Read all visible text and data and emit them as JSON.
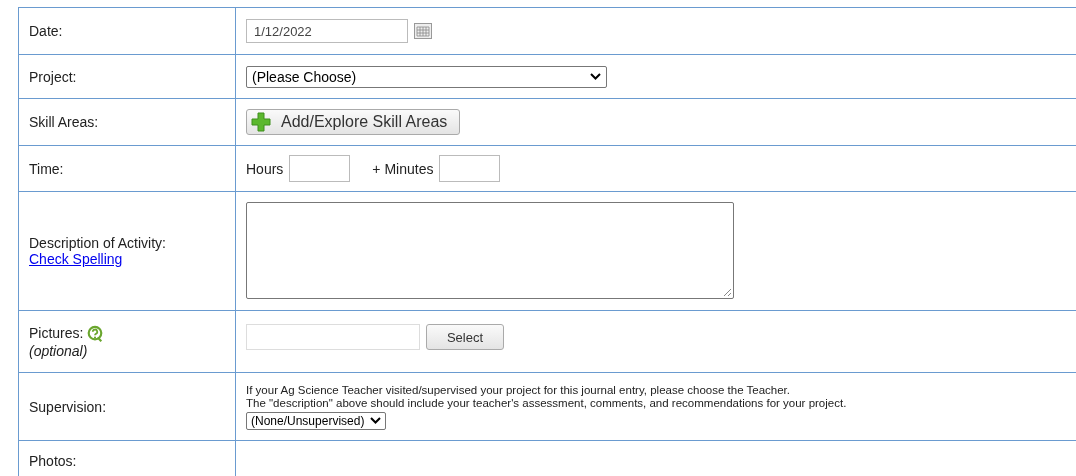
{
  "rows": [
    {
      "kind": "date",
      "label": "Date:",
      "value": "1/12/2022"
    },
    {
      "kind": "select",
      "label": "Project:",
      "value": "(Please Choose)"
    },
    {
      "kind": "button",
      "label": "Skill Areas:",
      "button": "Add/Explore Skill Areas"
    },
    {
      "kind": "time",
      "label": "Time:",
      "hours_label": "Hours",
      "minutes_label": "+ Minutes"
    },
    {
      "kind": "textarea",
      "label": "Description of Activity:",
      "link": "Check Spelling"
    },
    {
      "kind": "pictures",
      "label": "Pictures:",
      "note": "(optional)",
      "button": "Select"
    },
    {
      "kind": "supervision",
      "label": "Supervision:",
      "lines": [
        "If your Ag Science Teacher visited/supervised your project for this journal entry, please choose the Teacher.",
        "The \"description\" above should include your teacher's assessment, comments, and recommendations for your project."
      ],
      "value": "(None/Unsupervised)"
    },
    {
      "kind": "empty",
      "label": "Photos:"
    }
  ]
}
